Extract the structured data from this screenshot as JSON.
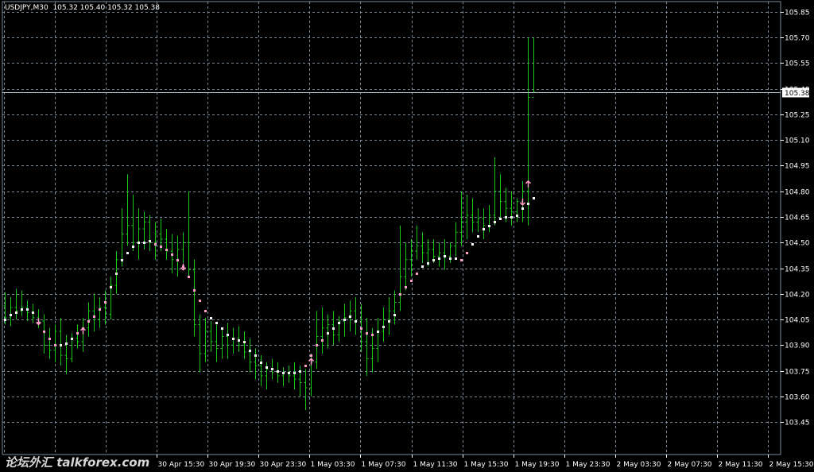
{
  "header": {
    "symbol": "USDJPY,M30",
    "ohlc": "105.32 105.40 105.32 105.38"
  },
  "watermark": {
    "text": "论坛外汇 talkforex.com"
  },
  "colors": {
    "background": "#000000",
    "grid": "#7a8a9a",
    "bars": "#19c819",
    "dot_white": "#ffffff",
    "dot_pink": "#ff9ec8",
    "arrow": "#ff9ec8",
    "axis_text": "#ffffff",
    "price_line": "#b0b8c4"
  },
  "chart_data": {
    "type": "ohlc",
    "title": "USDJPY,M30",
    "y_ticks": [
      "105.85",
      "105.70",
      "105.55",
      "105.40",
      "105.25",
      "105.10",
      "104.95",
      "104.80",
      "104.65",
      "104.50",
      "104.35",
      "104.20",
      "104.05",
      "103.90",
      "103.75",
      "103.60",
      "103.45"
    ],
    "x_ticks": [
      "30 Apr 15:30",
      "30 Apr 19:30",
      "30 Apr 23:30",
      "1 May 03:30",
      "1 May 07:30",
      "1 May 11:30",
      "1 May 15:30",
      "1 May 19:30",
      "1 May 23:30",
      "2 May 03:30",
      "2 May 07:30",
      "2 May 11:30",
      "2 May 15:30"
    ],
    "ylim": [
      103.4,
      105.9
    ],
    "current_price": "105.38",
    "bars_count": 96,
    "bars": [
      [
        104.13,
        104.21,
        104.02,
        104.06
      ],
      [
        104.06,
        104.18,
        104.01,
        104.12
      ],
      [
        104.12,
        104.23,
        104.05,
        104.1
      ],
      [
        104.1,
        104.22,
        104.07,
        104.12
      ],
      [
        104.12,
        104.16,
        104.04,
        104.09
      ],
      [
        104.09,
        104.14,
        104.03,
        104.06
      ],
      [
        104.06,
        104.11,
        104.0,
        104.04
      ],
      [
        104.04,
        104.08,
        103.85,
        103.9
      ],
      [
        103.9,
        104.0,
        103.82,
        103.87
      ],
      [
        103.87,
        104.02,
        103.8,
        103.98
      ],
      [
        103.98,
        104.06,
        103.78,
        103.84
      ],
      [
        103.84,
        103.96,
        103.73,
        103.82
      ],
      [
        103.82,
        103.97,
        103.8,
        103.94
      ],
      [
        103.94,
        104.02,
        103.88,
        103.92
      ],
      [
        103.92,
        104.06,
        103.86,
        104.0
      ],
      [
        104.0,
        104.15,
        103.95,
        104.1
      ],
      [
        104.1,
        104.2,
        103.98,
        104.05
      ],
      [
        104.05,
        104.18,
        104.0,
        104.12
      ],
      [
        104.12,
        104.22,
        104.02,
        104.08
      ],
      [
        104.08,
        104.3,
        104.05,
        104.25
      ],
      [
        104.25,
        104.45,
        104.2,
        104.4
      ],
      [
        104.4,
        104.7,
        104.36,
        104.55
      ],
      [
        104.55,
        104.9,
        104.48,
        104.6
      ],
      [
        104.6,
        104.78,
        104.45,
        104.5
      ],
      [
        104.5,
        104.7,
        104.4,
        104.58
      ],
      [
        104.58,
        104.68,
        104.46,
        104.62
      ],
      [
        104.62,
        104.66,
        104.45,
        104.5
      ],
      [
        104.5,
        104.62,
        104.4,
        104.55
      ],
      [
        104.55,
        104.64,
        104.45,
        104.52
      ],
      [
        104.52,
        104.58,
        104.4,
        104.45
      ],
      [
        104.45,
        104.55,
        104.32,
        104.4
      ],
      [
        104.4,
        104.54,
        104.3,
        104.46
      ],
      [
        104.46,
        104.56,
        104.38,
        104.5
      ],
      [
        104.5,
        104.8,
        104.3,
        104.34
      ],
      [
        104.34,
        104.4,
        103.95,
        104.02
      ],
      [
        104.02,
        104.08,
        103.74,
        103.85
      ],
      [
        103.85,
        104.06,
        103.8,
        103.98
      ],
      [
        103.98,
        104.04,
        103.86,
        103.92
      ],
      [
        103.92,
        104.02,
        103.8,
        103.88
      ],
      [
        103.88,
        103.99,
        103.82,
        103.95
      ],
      [
        103.95,
        104.03,
        103.82,
        103.9
      ],
      [
        103.9,
        104.0,
        103.85,
        103.94
      ],
      [
        103.94,
        104.01,
        103.86,
        103.9
      ],
      [
        103.9,
        103.98,
        103.82,
        103.86
      ],
      [
        103.86,
        103.94,
        103.74,
        103.8
      ],
      [
        103.8,
        103.88,
        103.7,
        103.78
      ],
      [
        103.78,
        103.84,
        103.66,
        103.72
      ],
      [
        103.72,
        103.8,
        103.64,
        103.76
      ],
      [
        103.76,
        103.82,
        103.7,
        103.74
      ],
      [
        103.74,
        103.8,
        103.68,
        103.72
      ],
      [
        103.72,
        103.77,
        103.66,
        103.74
      ],
      [
        103.74,
        103.78,
        103.68,
        103.72
      ],
      [
        103.72,
        103.8,
        103.64,
        103.7
      ],
      [
        103.7,
        103.78,
        103.6,
        103.68
      ],
      [
        103.68,
        103.76,
        103.52,
        103.65
      ],
      [
        103.65,
        103.85,
        103.6,
        103.8
      ],
      [
        103.8,
        104.1,
        103.76,
        103.95
      ],
      [
        103.95,
        104.12,
        103.85,
        104.0
      ],
      [
        104.0,
        104.08,
        103.88,
        104.02
      ],
      [
        104.02,
        104.1,
        103.9,
        103.96
      ],
      [
        103.96,
        104.07,
        103.92,
        104.04
      ],
      [
        104.04,
        104.14,
        103.95,
        104.06
      ],
      [
        104.06,
        104.16,
        103.98,
        104.1
      ],
      [
        104.1,
        104.18,
        103.96,
        104.04
      ],
      [
        104.04,
        104.14,
        103.86,
        103.92
      ],
      [
        103.92,
        104.06,
        103.72,
        103.82
      ],
      [
        103.82,
        104.0,
        103.74,
        103.88
      ],
      [
        103.88,
        104.06,
        103.8,
        103.98
      ],
      [
        103.98,
        104.12,
        103.92,
        104.05
      ],
      [
        104.05,
        104.18,
        103.96,
        104.1
      ],
      [
        104.1,
        104.22,
        104.02,
        104.15
      ],
      [
        104.15,
        104.6,
        104.1,
        104.3
      ],
      [
        104.3,
        104.5,
        104.22,
        104.4
      ],
      [
        104.4,
        104.52,
        104.3,
        104.45
      ],
      [
        104.45,
        104.6,
        104.4,
        104.48
      ],
      [
        104.48,
        104.56,
        104.38,
        104.44
      ],
      [
        104.44,
        104.52,
        104.36,
        104.46
      ],
      [
        104.46,
        104.52,
        104.38,
        104.42
      ],
      [
        104.42,
        104.5,
        104.36,
        104.44
      ],
      [
        104.44,
        104.52,
        104.34,
        104.42
      ],
      [
        104.42,
        104.5,
        104.38,
        104.48
      ],
      [
        104.48,
        104.62,
        104.42,
        104.56
      ],
      [
        104.56,
        104.8,
        104.48,
        104.62
      ],
      [
        104.62,
        104.78,
        104.52,
        104.66
      ],
      [
        104.66,
        104.76,
        104.56,
        104.62
      ],
      [
        104.62,
        104.7,
        104.56,
        104.64
      ],
      [
        104.64,
        104.7,
        104.52,
        104.6
      ],
      [
        104.6,
        104.72,
        104.56,
        104.66
      ],
      [
        104.66,
        105.0,
        104.6,
        104.8
      ],
      [
        104.8,
        104.9,
        104.64,
        104.74
      ],
      [
        104.74,
        104.82,
        104.62,
        104.7
      ],
      [
        104.7,
        104.8,
        104.6,
        104.68
      ],
      [
        104.68,
        104.76,
        104.62,
        104.74
      ],
      [
        104.74,
        104.86,
        104.62,
        104.8
      ],
      [
        104.8,
        105.7,
        104.6,
        105.35
      ],
      [
        105.35,
        105.7,
        105.38,
        105.38
      ]
    ],
    "dots": [
      [
        104.05,
        "w"
      ],
      [
        104.08,
        "w"
      ],
      [
        104.09,
        "w"
      ],
      [
        104.11,
        "w"
      ],
      [
        104.11,
        "w"
      ],
      [
        104.09,
        "w"
      ],
      [
        104.03,
        "p"
      ],
      [
        103.98,
        "p"
      ],
      [
        103.94,
        "p"
      ],
      [
        103.9,
        "p"
      ],
      [
        103.9,
        "w"
      ],
      [
        103.91,
        "w"
      ],
      [
        103.94,
        "w"
      ],
      [
        103.97,
        "p"
      ],
      [
        104.0,
        "p"
      ],
      [
        104.04,
        "p"
      ],
      [
        104.07,
        "p"
      ],
      [
        104.11,
        "p"
      ],
      [
        104.15,
        "p"
      ],
      [
        104.24,
        "w"
      ],
      [
        104.32,
        "w"
      ],
      [
        104.4,
        "w"
      ],
      [
        104.44,
        "w"
      ],
      [
        104.48,
        "w"
      ],
      [
        104.5,
        "w"
      ],
      [
        104.5,
        "w"
      ],
      [
        104.51,
        "w"
      ],
      [
        104.49,
        "p"
      ],
      [
        104.48,
        "p"
      ],
      [
        104.46,
        "p"
      ],
      [
        104.43,
        "p"
      ],
      [
        104.4,
        "p"
      ],
      [
        104.36,
        "p"
      ],
      [
        104.3,
        "p"
      ],
      [
        104.22,
        "p"
      ],
      [
        104.16,
        "p"
      ],
      [
        104.1,
        "p"
      ],
      [
        104.06,
        "w"
      ],
      [
        104.03,
        "w"
      ],
      [
        104.0,
        "w"
      ],
      [
        103.96,
        "w"
      ],
      [
        103.94,
        "w"
      ],
      [
        103.93,
        "w"
      ],
      [
        103.92,
        "w"
      ],
      [
        103.87,
        "w"
      ],
      [
        103.84,
        "w"
      ],
      [
        103.8,
        "w"
      ],
      [
        103.77,
        "w"
      ],
      [
        103.76,
        "w"
      ],
      [
        103.75,
        "w"
      ],
      [
        103.74,
        "w"
      ],
      [
        103.74,
        "w"
      ],
      [
        103.74,
        "w"
      ],
      [
        103.75,
        "w"
      ],
      [
        103.78,
        "p"
      ],
      [
        103.84,
        "p"
      ],
      [
        103.9,
        "p"
      ],
      [
        103.93,
        "p"
      ],
      [
        103.97,
        "w"
      ],
      [
        104.0,
        "w"
      ],
      [
        104.03,
        "w"
      ],
      [
        104.05,
        "w"
      ],
      [
        104.07,
        "w"
      ],
      [
        104.04,
        "w"
      ],
      [
        104.0,
        "p"
      ],
      [
        103.97,
        "p"
      ],
      [
        103.96,
        "p"
      ],
      [
        103.98,
        "w"
      ],
      [
        104.01,
        "w"
      ],
      [
        104.04,
        "w"
      ],
      [
        104.08,
        "w"
      ],
      [
        104.2,
        "p"
      ],
      [
        104.24,
        "p"
      ],
      [
        104.28,
        "p"
      ],
      [
        104.32,
        "p"
      ],
      [
        104.36,
        "w"
      ],
      [
        104.38,
        "w"
      ],
      [
        104.4,
        "w"
      ],
      [
        104.41,
        "w"
      ],
      [
        104.42,
        "w"
      ],
      [
        104.41,
        "w"
      ],
      [
        104.41,
        "w"
      ],
      [
        104.4,
        "p"
      ],
      [
        104.44,
        "p"
      ],
      [
        104.49,
        "w"
      ],
      [
        104.54,
        "w"
      ],
      [
        104.58,
        "w"
      ],
      [
        104.6,
        "w"
      ],
      [
        104.62,
        "w"
      ],
      [
        104.64,
        "w"
      ],
      [
        104.65,
        "w"
      ],
      [
        104.65,
        "w"
      ],
      [
        104.66,
        "w"
      ],
      [
        104.7,
        "w"
      ],
      [
        104.73,
        "w"
      ],
      [
        104.76,
        "w"
      ]
    ],
    "arrows": [
      [
        6,
        "down",
        104.02
      ],
      [
        14,
        "up",
        104.0
      ],
      [
        32,
        "down",
        104.34
      ],
      [
        55,
        "up",
        103.82
      ],
      [
        93,
        "down",
        104.72
      ],
      [
        94,
        "up",
        104.86
      ]
    ]
  }
}
